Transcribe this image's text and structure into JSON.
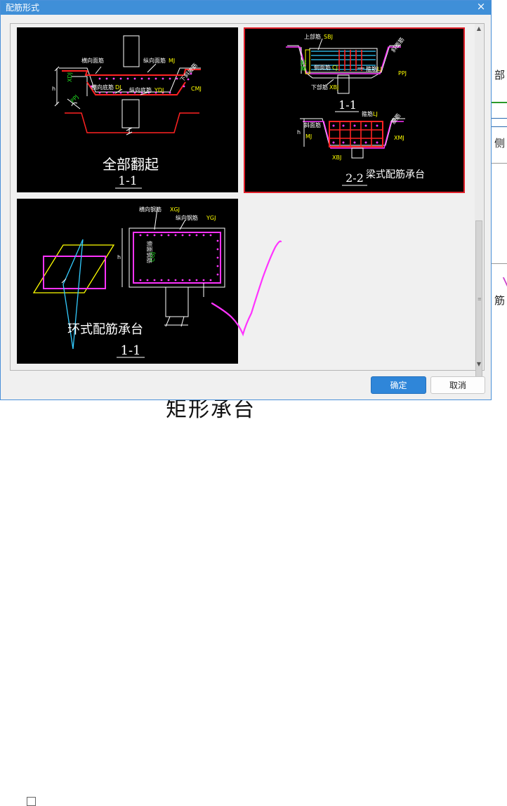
{
  "dialog": {
    "title": "配筋形式",
    "close_glyph": "×",
    "ok_label": "确定",
    "cancel_label": "取消",
    "accent_color": "#3f8fd8",
    "selection_color": "#e0202a"
  },
  "thumbnails": [
    {
      "name": "全部翻起",
      "caption": "全部翻起",
      "section": "1-1",
      "selected": false,
      "labels": {
        "transverse_face": "横向面筋",
        "longitudinal_face": "纵向面筋",
        "longitudinal_face_code": "MJ",
        "transverse_bottom": "横向底筋",
        "transverse_bottom_code": "DJ",
        "longitudinal_bottom": "纵向底筋",
        "longitudinal_bottom_code": "YDJ",
        "slope_bar": "下斜坡筋",
        "code_cmj": "CMJ",
        "code_xdj": "XDJ",
        "code_ppj": "PPJ",
        "code_h": "h"
      }
    },
    {
      "name": "梁式配筋承台",
      "caption": "梁式配筋承台",
      "section": "1-1",
      "section2": "2-2",
      "selected": true,
      "labels": {
        "top_bar": "上部筋",
        "top_code": "SBJ",
        "waist_bar": "腰筋",
        "waist_code": "YJ",
        "side_bar": "侧面筋",
        "side_code": "CJ",
        "bottom_bar": "下部筋",
        "bottom_code": "XBJ",
        "stirrup": "箍筋",
        "stirrup_code": "LJ",
        "slope": "斜面筋",
        "code_ppj": "PPJ",
        "code_xbj": "XBJ",
        "code_mj": "MJ",
        "code_xmj": "XMJ",
        "code_h": "h"
      }
    },
    {
      "name": "环式配筋承台",
      "caption": "环式配筋承台",
      "section": "1-1",
      "selected": false,
      "labels": {
        "transverse": "横向钢筋",
        "transverse_code": "XGJ",
        "longitudinal": "纵向钢筋",
        "longitudinal_code": "YGJ",
        "side": "侧面钢筋",
        "side_code": "CGJ",
        "code_h": "h"
      }
    }
  ],
  "background": {
    "right_fragments": [
      "部",
      "侧",
      "筋"
    ],
    "bottom_text": "矩形承台"
  }
}
